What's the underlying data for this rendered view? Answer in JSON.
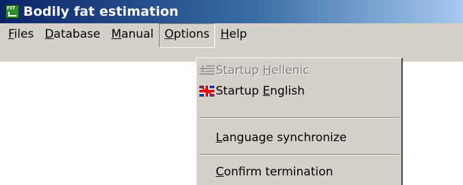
{
  "window": {
    "title": "Bodily fat estimation",
    "icon": "fit-app-icon"
  },
  "menubar": {
    "items": [
      {
        "label_pre": "",
        "label_u": "F",
        "label_post": "iles"
      },
      {
        "label_pre": "",
        "label_u": "D",
        "label_post": "atabase"
      },
      {
        "label_pre": "",
        "label_u": "M",
        "label_post": "anual"
      },
      {
        "label_pre": "",
        "label_u": "O",
        "label_post": "ptions"
      },
      {
        "label_pre": "",
        "label_u": "H",
        "label_post": "elp"
      }
    ],
    "active_index": 3
  },
  "options_menu": {
    "items": [
      {
        "pre": "Startup ",
        "u": "H",
        "post": "ellenic",
        "icon": "greek-flag-icon",
        "disabled": true
      },
      {
        "pre": "Startup ",
        "u": "E",
        "post": "nglish",
        "icon": "uk-flag-icon",
        "disabled": false
      },
      {
        "pre": "",
        "u": "L",
        "post": "anguage synchronize",
        "disabled": false
      },
      {
        "pre": "",
        "u": "C",
        "post": "onfirm termination",
        "disabled": false
      }
    ]
  },
  "colors": {
    "titlebar_start": "#0a246a",
    "titlebar_end": "#a6caf0",
    "menu_bg": "#d4d0c8",
    "disabled_text": "#808080"
  }
}
